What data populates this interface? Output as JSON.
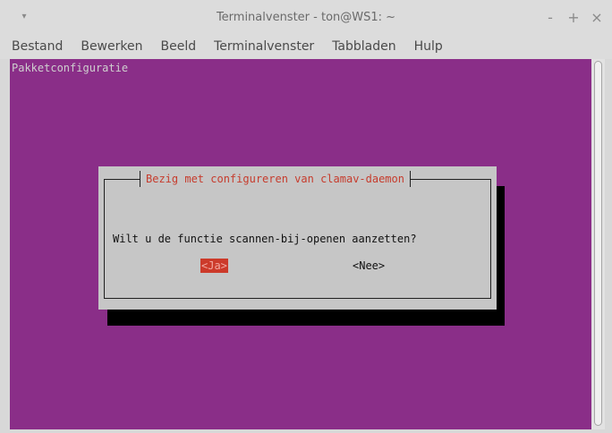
{
  "window": {
    "title": "Terminalvenster - ton@WS1: ~",
    "controls": [
      "-",
      "+",
      "×"
    ]
  },
  "menubar": {
    "items": [
      "Bestand",
      "Bewerken",
      "Beeld",
      "Terminalvenster",
      "Tabbladen",
      "Hulp"
    ]
  },
  "terminal": {
    "header": "Pakketconfiguratie",
    "dialog": {
      "title": "Bezig met configureren van clamav-daemon",
      "question": "Wilt u de functie scannen-bij-openen aanzetten?",
      "yes_label": "<Ja>",
      "no_label": "<Nee>"
    }
  },
  "colors": {
    "terminal_background": "#8a2e88",
    "dialog_background": "#c6c6c6",
    "dialog_title": "#c63c2d",
    "selected_button": "#cc3a2a"
  },
  "icons": {
    "window_menu": "chevron-down-icon",
    "minimize": "minimize-icon",
    "maximize": "maximize-icon",
    "close": "close-icon"
  }
}
